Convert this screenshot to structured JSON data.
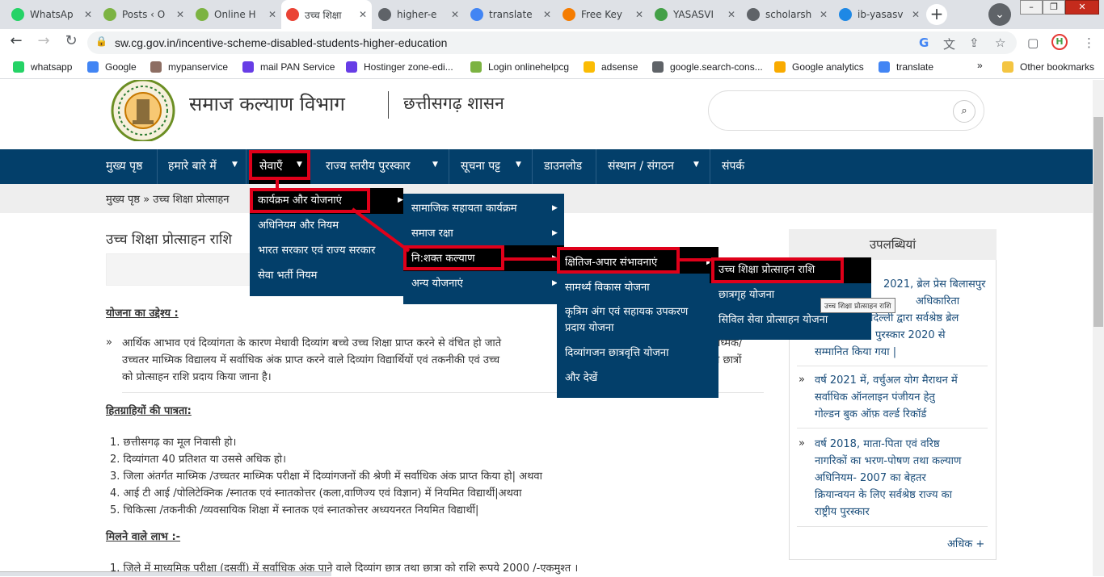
{
  "browser": {
    "tabs": [
      {
        "title": "WhatsAp",
        "icon": "whatsapp-icon",
        "color": "#25d366"
      },
      {
        "title": "Posts ‹ O",
        "icon": "onlinehelp-icon",
        "color": "#7cb342"
      },
      {
        "title": "Online H",
        "icon": "onlinehelp-icon",
        "color": "#7cb342"
      },
      {
        "title": "उच्च शिक्षा",
        "icon": "google-icon",
        "color": "#ea4335",
        "active": true
      },
      {
        "title": "higher-e",
        "icon": "globe-icon",
        "color": "#5f6368"
      },
      {
        "title": "translate",
        "icon": "google-icon",
        "color": "#4285f4"
      },
      {
        "title": "Free Key",
        "icon": "amazon-icon",
        "color": "#f57c00"
      },
      {
        "title": "YASASVI",
        "icon": "check-icon",
        "color": "#43a047"
      },
      {
        "title": "scholarsh",
        "icon": "globe-icon",
        "color": "#5f6368"
      },
      {
        "title": "ib-yasasv",
        "icon": "grid-icon",
        "color": "#1e88e5"
      }
    ],
    "new_tab": "+",
    "url": "sw.cg.gov.in/incentive-scheme-disabled-students-higher-education",
    "bookmarks": [
      {
        "label": "whatsapp",
        "icon": "whatsapp-icon",
        "color": "#25d366"
      },
      {
        "label": "Google",
        "icon": "google-icon",
        "color": "#4285f4"
      },
      {
        "label": "mypanservice",
        "icon": "emblem-icon",
        "color": "#8d6e63"
      },
      {
        "label": "mail PAN Service",
        "icon": "hostinger-icon",
        "color": "#673de6"
      },
      {
        "label": "Hostinger zone-edi...",
        "icon": "hostinger-icon",
        "color": "#673de6"
      },
      {
        "label": "Login onlinehelpcg",
        "icon": "onlinehelp-icon",
        "color": "#7cb342"
      },
      {
        "label": "adsense",
        "icon": "adsense-icon",
        "color": "#fbbc04"
      },
      {
        "label": "google.search-cons...",
        "icon": "search-console-icon",
        "color": "#5f6368"
      },
      {
        "label": "Google analytics",
        "icon": "analytics-icon",
        "color": "#f9ab00"
      },
      {
        "label": "translate",
        "icon": "google-icon",
        "color": "#4285f4"
      }
    ],
    "overflow": "»",
    "other_bookmarks": "Other bookmarks"
  },
  "site": {
    "dept_name": "समाज कल्याण विभाग",
    "govt_name": "छत्तीसगढ़ शासन",
    "nav": [
      "मुख्य पृष्ठ",
      "हमारे बारे में",
      "सेवाएँ",
      "राज्य स्तरीय पुरस्कार",
      "सूचना पट्ट",
      "डाउनलोड",
      "संस्थान / संगठन",
      "संपर्क"
    ],
    "breadcrumb": "मुख्य पृष्ठ » उच्च शिक्षा प्रोत्साहन",
    "page_title": "उच्च शिक्षा प्रोत्साहन राशि",
    "objective_heading": "योजना का उद्देश्य :",
    "objective_lines": [
      "आर्थिक आभाव एवं दिव्यांगता के कारण मेधावी दिव्यांग बच्चे उच्च शिक्षा प्राप्त करने से वंचित हो जाते",
      "उच्चतर माध्मिक विद्यालय में सर्वाधिक अंक प्राप्त करने वाले दिव्यांग विद्यार्थियों एवं तकनीकी एवं उच्च",
      "को प्रोत्साहन राशि प्रदाय किया जाना है।"
    ],
    "objective_tail": [
      "ध्मिक/",
      "ग छात्रों"
    ],
    "eligibility_heading": "हितग्राहियों की पात्रता:",
    "eligibility": [
      "1. छत्तीसगढ़ का मूल निवासी हो।",
      "2. दिव्यांगता 40 प्रतिशत या उससे अधिक हो।",
      "3. जिला अंतर्गत माध्मिक /उच्चतर माध्मिक परीक्षा में दिव्यांगजनों की श्रेणी में सर्वाधिक अंक प्राप्त किया हो| अथवा",
      "4. आई टी आई /पोलिटेक्निक /स्नातक एवं स्नातकोत्तर (कला,वाणिज्य एवं विज्ञान) में नियमित विद्यार्थी|अथवा",
      "5. चिकित्सा /तकनीकी /व्यवसायिक शिक्षा में स्नातक एवं स्नातकोत्तर अध्ययनरत नियमित विद्यार्थी|"
    ],
    "benefits_heading": "मिलने वाले लाभ :-",
    "benefit_first": "1. जिले में माध्यमिक परीक्षा (दसवीं) में सर्वाधिक अंक पाने वाले दिव्यांग छात्र तथा छात्रा को राशि रूपये 2000 /-एकमुश्त ।",
    "sidebar": {
      "heading": "उपलब्धियां",
      "item1": [
        "2021, ब्रेल प्रेस बिलासपुर",
        "अधिकारिता",
        "दिल्ली द्वारा सर्वश्रेष्ठ ब्रेल",
        "पुरस्कार 2020 से",
        "सम्मानित किया गया |"
      ],
      "item2": [
        "वर्ष 2021 में, वर्चुअल योग मैराथन में",
        "सर्वाधिक ऑनलाइन पंजीयन हेतु",
        "गोल्डन बुक ऑफ़ वर्ल्ड रिकॉर्ड"
      ],
      "item3": [
        "वर्ष 2018, माता-पिता एवं वरिष्ठ",
        "नागरिकों का भरण-पोषण तथा कल्याण",
        "अधिनियम- 2007 का बेहतर",
        "क्रियान्वयन के लिए सर्वश्रेष्ठ राज्य का",
        "राष्ट्रीय पुरस्कार"
      ],
      "more": "अधिक +"
    }
  },
  "menus": {
    "level1": [
      "कार्यक्रम और योजनाएं",
      "अधिनियम और नियम",
      "भारत सरकार एवं राज्य सरकार",
      "सेवा भर्ती नियम"
    ],
    "level2": [
      "सामाजिक सहायता कार्यक्रम",
      "समाज रक्षा",
      "नि:शक्त कल्याण",
      "अन्य योजनाएं"
    ],
    "level3": [
      "क्षितिज-अपार संभावनाएं",
      "सामर्थ्य विकास योजना",
      "कृत्रिम अंग एवं सहायक उपकरण",
      "प्रदाय योजना",
      "दिव्यांगजन छात्रवृत्ति योजना",
      "और देखें"
    ],
    "level4": [
      "उच्च शिक्षा प्रोत्साहन राशि",
      "छात्रगृह योजना",
      "सिविल सेवा प्रोत्साहन योजना"
    ],
    "tooltip": "उच्च शिक्षा प्रोत्साहन राशि"
  },
  "colors": {
    "nav_bg": "#033f6a",
    "highlight": "#e0001a"
  }
}
